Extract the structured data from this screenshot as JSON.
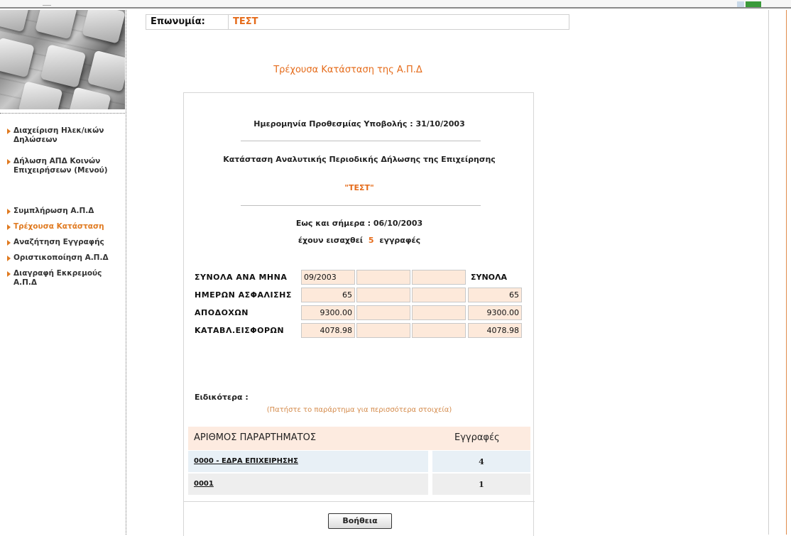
{
  "company": {
    "label": "Επωνυμία:",
    "value": "ΤΕΣΤ"
  },
  "page_title": "Τρέχουσα Κατάσταση της Α.Π.Δ",
  "sidebar": {
    "items": [
      {
        "label": "Διαχείριση Ηλεκ/ικών Δηλώσεων",
        "active": false
      },
      {
        "label": "Δήλωση ΑΠΔ Κοινών Επιχειρήσεων (Μενού)",
        "active": false
      },
      {
        "label": "Συμπλήρωση Α.Π.Δ",
        "active": false
      },
      {
        "label": "Τρέχουσα Κατάσταση",
        "active": true
      },
      {
        "label": "Αναζήτηση Εγγραφής",
        "active": false
      },
      {
        "label": "Οριστικοποίηση Α.Π.Δ",
        "active": false
      },
      {
        "label": "Διαγραφή Εκκρεμούς Α.Π.Δ",
        "active": false
      }
    ]
  },
  "deadline": {
    "label": "Ημερομηνία Προθεσμίας Υποβολής :",
    "value": "31/10/2003"
  },
  "status_heading": "Κατάσταση Αναλυτικής Περιοδικής Δήλωσης της Επιχείρησης",
  "company_quoted": "\"ΤΕΣΤ\"",
  "as_of": {
    "label": "Εως και σήμερα :",
    "value": "06/10/2003"
  },
  "entered": {
    "prefix": "έχουν εισαχθεί",
    "count": "5",
    "suffix": "εγγραφές"
  },
  "totals": {
    "header": {
      "label": "ΣΥΝΟΛΑ ΑΝΑ ΜΗΝΑ",
      "months": [
        "09/2003",
        "",
        ""
      ],
      "total_label": "ΣΥΝΟΛΑ"
    },
    "rows": [
      {
        "label": "ΗΜΕΡΩΝ ΑΣΦΑΛΙΣΗΣ",
        "values": [
          "65",
          "",
          ""
        ],
        "total": "65"
      },
      {
        "label": "ΑΠΟΔΟΧΩΝ",
        "values": [
          "9300.00",
          "",
          ""
        ],
        "total": "9300.00"
      },
      {
        "label": "ΚΑΤΑΒΛ.ΕΙΣΦΟΡΩΝ",
        "values": [
          "4078.98",
          "",
          ""
        ],
        "total": "4078.98"
      }
    ]
  },
  "details": {
    "label": "Ειδικότερα :",
    "hint": "(Πατήστε το παράρτημα για περισσότερα στοιχεία)",
    "columns": [
      "ΑΡΙΘΜΟΣ ΠΑΡΑΡΤΗΜΑΤΟΣ",
      "Εγγραφές"
    ],
    "rows": [
      {
        "branch": "0000 - ΕΔΡΑ ΕΠΙΧΕΙΡΗΣΗΣ",
        "count": "4"
      },
      {
        "branch": "0001",
        "count": "1"
      }
    ]
  },
  "help_button": "Βοήθεια"
}
